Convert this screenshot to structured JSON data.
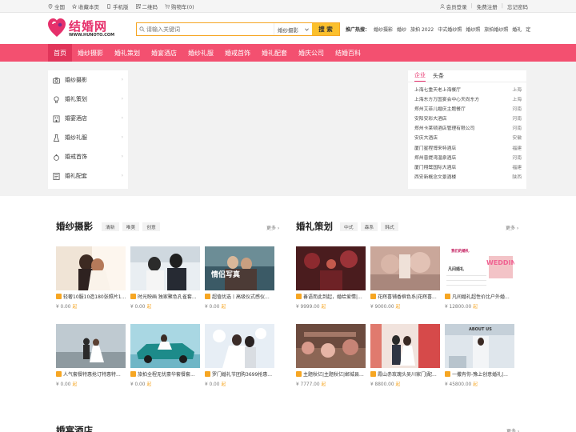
{
  "topbar": {
    "left": [
      {
        "label": "全国",
        "icon": "location-icon"
      },
      {
        "label": "收藏本页",
        "icon": "star-icon"
      },
      {
        "label": "手机版",
        "icon": "mobile-icon"
      },
      {
        "label": "二维码",
        "icon": "qrcode-icon"
      },
      {
        "label": "购物车(0)",
        "icon": "cart-icon"
      }
    ],
    "right": {
      "login": "会员登录",
      "register": "免费注册",
      "forgot": "忘记密码"
    }
  },
  "header": {
    "brand": "结婚网",
    "url": "WWW.HUNOTO.COM",
    "search_placeholder": "请输入关键词",
    "search_category": "婚纱摄影",
    "search_button": "搜 索",
    "hot_label": "推广热搜：",
    "hot": [
      "婚纱摄影",
      "婚纱",
      "旅拍 2022",
      "中式婚纱照",
      "婚纱照",
      "旅拍婚纱照",
      "婚礼",
      "定"
    ]
  },
  "nav": [
    "首页",
    "婚纱摄影",
    "婚礼策划",
    "婚宴酒店",
    "婚纱礼服",
    "婚戒首饰",
    "婚礼配套",
    "婚庆公司",
    "结婚百科"
  ],
  "categories": [
    {
      "label": "婚纱摄影",
      "icon": "camera-icon"
    },
    {
      "label": "婚礼策划",
      "icon": "bulb-icon"
    },
    {
      "label": "婚宴酒店",
      "icon": "hotel-icon"
    },
    {
      "label": "婚纱礼服",
      "icon": "dress-icon"
    },
    {
      "label": "婚戒首饰",
      "icon": "ring-icon"
    },
    {
      "label": "婚礼配套",
      "icon": "list-icon"
    }
  ],
  "news": {
    "tabs": [
      "企业",
      "头条"
    ],
    "items": [
      {
        "name": "上海七重天老上海餐厅",
        "region": "上海"
      },
      {
        "name": "上海东方万国宴会中心天尚东方",
        "region": "上海"
      },
      {
        "name": "郑州艾菲儿婚庆主题餐厅",
        "region": "河南"
      },
      {
        "name": "安阳安彩大酒店",
        "region": "河南"
      },
      {
        "name": "郑州卡莱顿酒店管理有限公司",
        "region": "河南"
      },
      {
        "name": "安庆大酒店",
        "region": "安徽"
      },
      {
        "name": "厦门星程博来特酒店",
        "region": "福建"
      },
      {
        "name": "郑州普提湾温泉酒店",
        "region": "河南"
      },
      {
        "name": "厦门翔鹭国际大酒店",
        "region": "福建"
      },
      {
        "name": "西安新概念文景酒楼",
        "region": "陕西"
      }
    ]
  },
  "sections": {
    "photo": {
      "title": "婚纱摄影",
      "tags": [
        "清新",
        "唯美",
        "创意"
      ],
      "more": "更多",
      "cards": [
        {
          "title": "轻奢10服10造180张照片1...",
          "price": "¥ 0.00",
          "unit": "起"
        },
        {
          "title": "时光映画 独家聚色孔雀套...",
          "price": "¥ 0.00",
          "unit": "起"
        },
        {
          "title": "超值优选丨高级仪式感仪...",
          "price": "¥ 0.00",
          "unit": "起"
        },
        {
          "title": "人气套餐特惠抢订特惠特...",
          "price": "¥ 0.00",
          "unit": "起"
        },
        {
          "title": "旅拍全程无忧豪华套餐套...",
          "price": "¥ 0.00",
          "unit": "起"
        },
        {
          "title": "罗门婚礼节团购3699抢惠...",
          "price": "¥ 0.00",
          "unit": "起"
        }
      ]
    },
    "plan": {
      "title": "婚礼策划",
      "tags": [
        "中式",
        "森系",
        "韩式"
      ],
      "more": "更多",
      "cards": [
        {
          "title": "善语而此到起，婚给爱情|...",
          "price": "¥ 9999.00",
          "unit": "起"
        },
        {
          "title": "花辉喜铺香槟色系|花辉喜...",
          "price": "¥ 9000.00",
          "unit": "起"
        },
        {
          "title": "凡间婚礼超性价比户外婚...",
          "price": "¥ 12800.00",
          "unit": "起"
        },
        {
          "title": "主题秋亿|主题秋亿|郸城县...",
          "price": "¥ 7777.00",
          "unit": "起"
        },
        {
          "title": "霞山赤玫瑰头吴川家门|配...",
          "price": "¥ 8800.00",
          "unit": "起"
        },
        {
          "title": "一撒有你-豫上创意婚礼|...",
          "price": "¥ 45800.00",
          "unit": "起"
        }
      ]
    },
    "hotel": {
      "title": "婚宴酒店",
      "more": "更多"
    }
  },
  "image_texts": {
    "couple_photo": "情侣写真",
    "wedding_board_line1": "我们的婚礼",
    "wedding_board_big": "WEDDING",
    "wedding_board_brand": "凡间婚礼",
    "about_us": "ABOUT US"
  },
  "colors": {
    "accent": "#f35070",
    "brand": "#e6306b",
    "button": "#fbc02d"
  }
}
